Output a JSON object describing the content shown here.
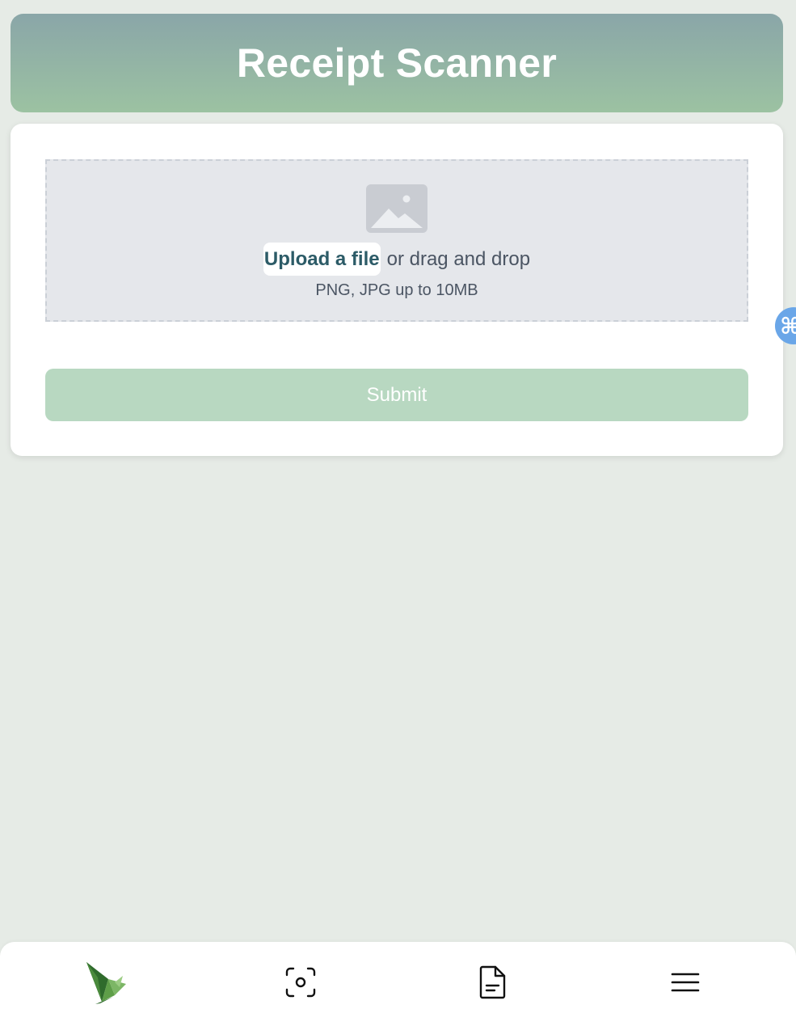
{
  "header": {
    "title": "Receipt Scanner"
  },
  "upload": {
    "icon": "photo-icon",
    "link_label": "Upload a file",
    "drag_text": "or drag and drop",
    "hint": "PNG, JPG up to 10MB"
  },
  "submit": {
    "label": "Submit"
  },
  "side_badge": {
    "icon": "command-icon",
    "glyph": "⌘",
    "color": "#6aa6e8"
  },
  "nav": {
    "items": [
      {
        "icon": "bird-logo-icon"
      },
      {
        "icon": "scan-icon"
      },
      {
        "icon": "document-icon"
      },
      {
        "icon": "menu-icon"
      }
    ]
  },
  "colors": {
    "background": "#e6ebe6",
    "header_gradient_top": "#8aa6a8",
    "header_gradient_bottom": "#9cc2a2",
    "submit": "#b8d8c1",
    "link": "#2c5b67"
  }
}
